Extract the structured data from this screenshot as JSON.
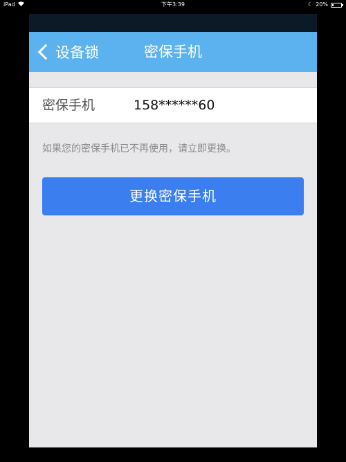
{
  "status_bar": {
    "device": "iPad",
    "time": "下午3:39",
    "battery": "20%",
    "battery_level": 0.2,
    "wifi_icon": "wifi-icon"
  },
  "nav": {
    "back_label": "设备锁",
    "title": "密保手机"
  },
  "phone_row": {
    "label": "密保手机",
    "value": "158******60"
  },
  "hint": "如果您的密保手机已不再使用，请立即更换。",
  "actions": {
    "change_label": "更换密保手机"
  },
  "colors": {
    "nav_background": "#5cb2ee",
    "primary_button": "#3a7ef0",
    "page_background": "#e8e8ea"
  }
}
